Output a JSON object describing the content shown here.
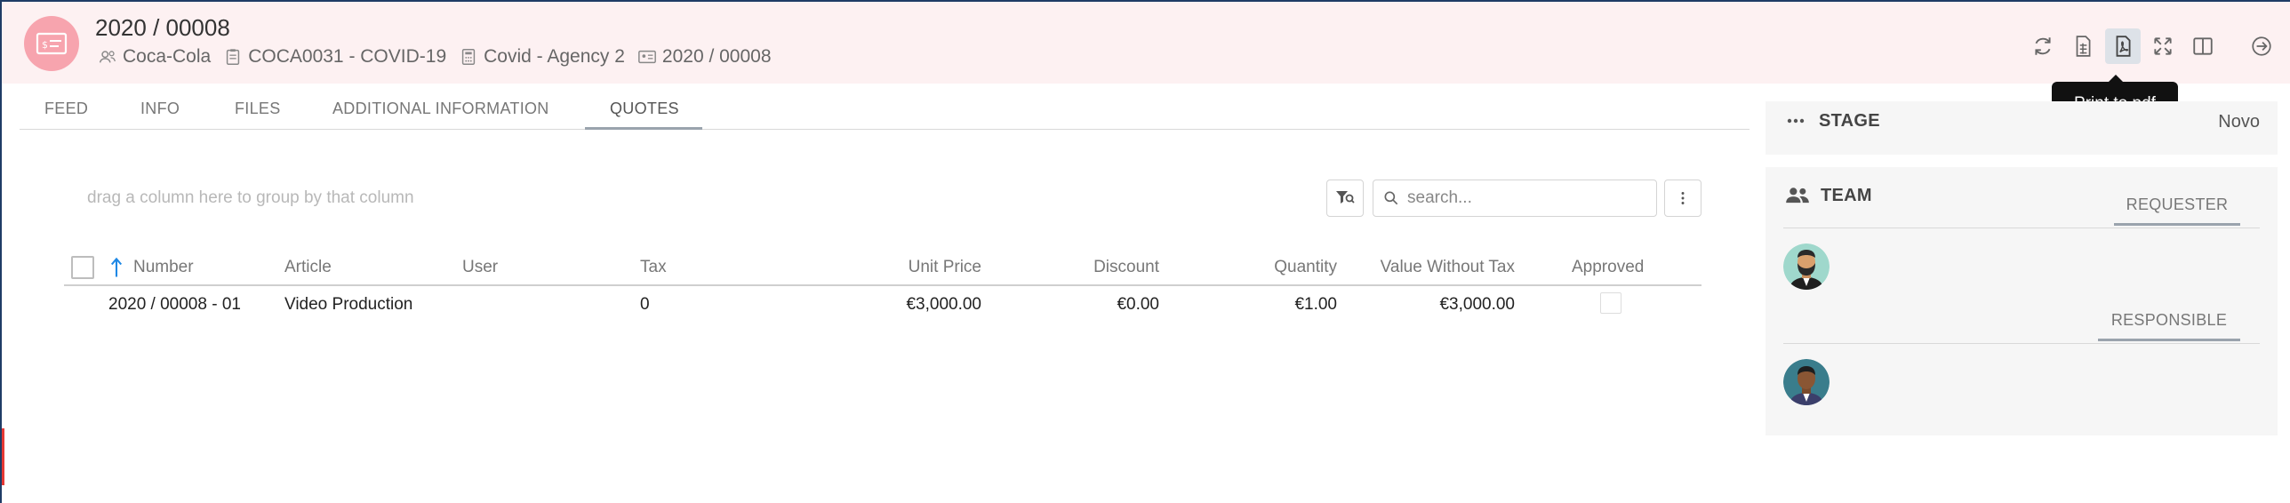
{
  "header": {
    "title": "2020 / 00008",
    "meta": {
      "client": "Coca-Cola",
      "project": "COCA0031 - COVID-19",
      "agency": "Covid - Agency 2",
      "reference": "2020 / 00008"
    },
    "tooltip": "Print to pdf"
  },
  "tabs": [
    {
      "label": "FEED"
    },
    {
      "label": "INFO"
    },
    {
      "label": "FILES"
    },
    {
      "label": "ADDITIONAL INFORMATION"
    },
    {
      "label": "QUOTES"
    }
  ],
  "active_tab": "QUOTES",
  "grid": {
    "group_hint": "drag a column here to group by that column",
    "search_placeholder": "search...",
    "columns": [
      "Number",
      "Article",
      "User",
      "Tax",
      "Unit Price",
      "Discount",
      "Quantity",
      "Value Without Tax",
      "Approved"
    ],
    "rows": [
      {
        "number": "2020 / 00008 - 01",
        "article": "Video Production",
        "user": "",
        "tax": "0",
        "unit_price": "€3,000.00",
        "discount": "€0.00",
        "quantity": "€1.00",
        "value_without_tax": "€3,000.00",
        "approved": false
      }
    ]
  },
  "panel": {
    "stage_label": "STAGE",
    "stage_value": "Novo",
    "team_label": "TEAM",
    "requester_label": "REQUESTER",
    "responsible_label": "RESPONSIBLE"
  },
  "colors": {
    "header_bg": "#fdf1f2",
    "avatar_bg": "#f7a4ae",
    "sort_arrow": "#1e88e5"
  }
}
